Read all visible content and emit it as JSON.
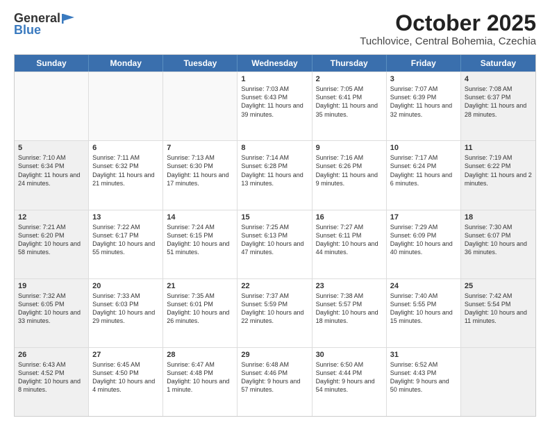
{
  "header": {
    "logo_general": "General",
    "logo_blue": "Blue",
    "month_title": "October 2025",
    "location": "Tuchlovice, Central Bohemia, Czechia"
  },
  "days_of_week": [
    "Sunday",
    "Monday",
    "Tuesday",
    "Wednesday",
    "Thursday",
    "Friday",
    "Saturday"
  ],
  "weeks": [
    [
      {
        "day": "",
        "text": "",
        "shaded": false,
        "empty": true
      },
      {
        "day": "",
        "text": "",
        "shaded": false,
        "empty": true
      },
      {
        "day": "",
        "text": "",
        "shaded": false,
        "empty": true
      },
      {
        "day": "1",
        "text": "Sunrise: 7:03 AM\nSunset: 6:43 PM\nDaylight: 11 hours and 39 minutes.",
        "shaded": false
      },
      {
        "day": "2",
        "text": "Sunrise: 7:05 AM\nSunset: 6:41 PM\nDaylight: 11 hours and 35 minutes.",
        "shaded": false
      },
      {
        "day": "3",
        "text": "Sunrise: 7:07 AM\nSunset: 6:39 PM\nDaylight: 11 hours and 32 minutes.",
        "shaded": false
      },
      {
        "day": "4",
        "text": "Sunrise: 7:08 AM\nSunset: 6:37 PM\nDaylight: 11 hours and 28 minutes.",
        "shaded": true
      }
    ],
    [
      {
        "day": "5",
        "text": "Sunrise: 7:10 AM\nSunset: 6:34 PM\nDaylight: 11 hours and 24 minutes.",
        "shaded": true
      },
      {
        "day": "6",
        "text": "Sunrise: 7:11 AM\nSunset: 6:32 PM\nDaylight: 11 hours and 21 minutes.",
        "shaded": false
      },
      {
        "day": "7",
        "text": "Sunrise: 7:13 AM\nSunset: 6:30 PM\nDaylight: 11 hours and 17 minutes.",
        "shaded": false
      },
      {
        "day": "8",
        "text": "Sunrise: 7:14 AM\nSunset: 6:28 PM\nDaylight: 11 hours and 13 minutes.",
        "shaded": false
      },
      {
        "day": "9",
        "text": "Sunrise: 7:16 AM\nSunset: 6:26 PM\nDaylight: 11 hours and 9 minutes.",
        "shaded": false
      },
      {
        "day": "10",
        "text": "Sunrise: 7:17 AM\nSunset: 6:24 PM\nDaylight: 11 hours and 6 minutes.",
        "shaded": false
      },
      {
        "day": "11",
        "text": "Sunrise: 7:19 AM\nSunset: 6:22 PM\nDaylight: 11 hours and 2 minutes.",
        "shaded": true
      }
    ],
    [
      {
        "day": "12",
        "text": "Sunrise: 7:21 AM\nSunset: 6:20 PM\nDaylight: 10 hours and 58 minutes.",
        "shaded": true
      },
      {
        "day": "13",
        "text": "Sunrise: 7:22 AM\nSunset: 6:17 PM\nDaylight: 10 hours and 55 minutes.",
        "shaded": false
      },
      {
        "day": "14",
        "text": "Sunrise: 7:24 AM\nSunset: 6:15 PM\nDaylight: 10 hours and 51 minutes.",
        "shaded": false
      },
      {
        "day": "15",
        "text": "Sunrise: 7:25 AM\nSunset: 6:13 PM\nDaylight: 10 hours and 47 minutes.",
        "shaded": false
      },
      {
        "day": "16",
        "text": "Sunrise: 7:27 AM\nSunset: 6:11 PM\nDaylight: 10 hours and 44 minutes.",
        "shaded": false
      },
      {
        "day": "17",
        "text": "Sunrise: 7:29 AM\nSunset: 6:09 PM\nDaylight: 10 hours and 40 minutes.",
        "shaded": false
      },
      {
        "day": "18",
        "text": "Sunrise: 7:30 AM\nSunset: 6:07 PM\nDaylight: 10 hours and 36 minutes.",
        "shaded": true
      }
    ],
    [
      {
        "day": "19",
        "text": "Sunrise: 7:32 AM\nSunset: 6:05 PM\nDaylight: 10 hours and 33 minutes.",
        "shaded": true
      },
      {
        "day": "20",
        "text": "Sunrise: 7:33 AM\nSunset: 6:03 PM\nDaylight: 10 hours and 29 minutes.",
        "shaded": false
      },
      {
        "day": "21",
        "text": "Sunrise: 7:35 AM\nSunset: 6:01 PM\nDaylight: 10 hours and 26 minutes.",
        "shaded": false
      },
      {
        "day": "22",
        "text": "Sunrise: 7:37 AM\nSunset: 5:59 PM\nDaylight: 10 hours and 22 minutes.",
        "shaded": false
      },
      {
        "day": "23",
        "text": "Sunrise: 7:38 AM\nSunset: 5:57 PM\nDaylight: 10 hours and 18 minutes.",
        "shaded": false
      },
      {
        "day": "24",
        "text": "Sunrise: 7:40 AM\nSunset: 5:55 PM\nDaylight: 10 hours and 15 minutes.",
        "shaded": false
      },
      {
        "day": "25",
        "text": "Sunrise: 7:42 AM\nSunset: 5:54 PM\nDaylight: 10 hours and 11 minutes.",
        "shaded": true
      }
    ],
    [
      {
        "day": "26",
        "text": "Sunrise: 6:43 AM\nSunset: 4:52 PM\nDaylight: 10 hours and 8 minutes.",
        "shaded": true
      },
      {
        "day": "27",
        "text": "Sunrise: 6:45 AM\nSunset: 4:50 PM\nDaylight: 10 hours and 4 minutes.",
        "shaded": false
      },
      {
        "day": "28",
        "text": "Sunrise: 6:47 AM\nSunset: 4:48 PM\nDaylight: 10 hours and 1 minute.",
        "shaded": false
      },
      {
        "day": "29",
        "text": "Sunrise: 6:48 AM\nSunset: 4:46 PM\nDaylight: 9 hours and 57 minutes.",
        "shaded": false
      },
      {
        "day": "30",
        "text": "Sunrise: 6:50 AM\nSunset: 4:44 PM\nDaylight: 9 hours and 54 minutes.",
        "shaded": false
      },
      {
        "day": "31",
        "text": "Sunrise: 6:52 AM\nSunset: 4:43 PM\nDaylight: 9 hours and 50 minutes.",
        "shaded": false
      },
      {
        "day": "",
        "text": "",
        "shaded": true,
        "empty": true
      }
    ]
  ]
}
